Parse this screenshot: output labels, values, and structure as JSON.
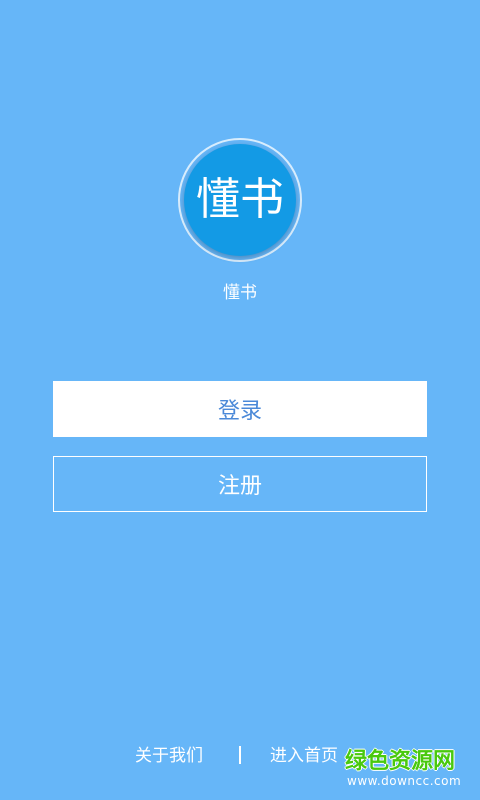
{
  "logo": {
    "text": "懂书"
  },
  "app": {
    "name": "懂书"
  },
  "buttons": {
    "login_label": "登录",
    "register_label": "注册"
  },
  "footer": {
    "about_label": "关于我们",
    "home_label": "进入首页"
  },
  "watermark": {
    "title": "绿色资源网",
    "url": "www.downcc.com"
  },
  "colors": {
    "background": "#66b6f8",
    "logo_circle": "#139ae5",
    "login_text": "#4b89d8",
    "white": "#ffffff",
    "watermark_green": "#48c90e"
  }
}
